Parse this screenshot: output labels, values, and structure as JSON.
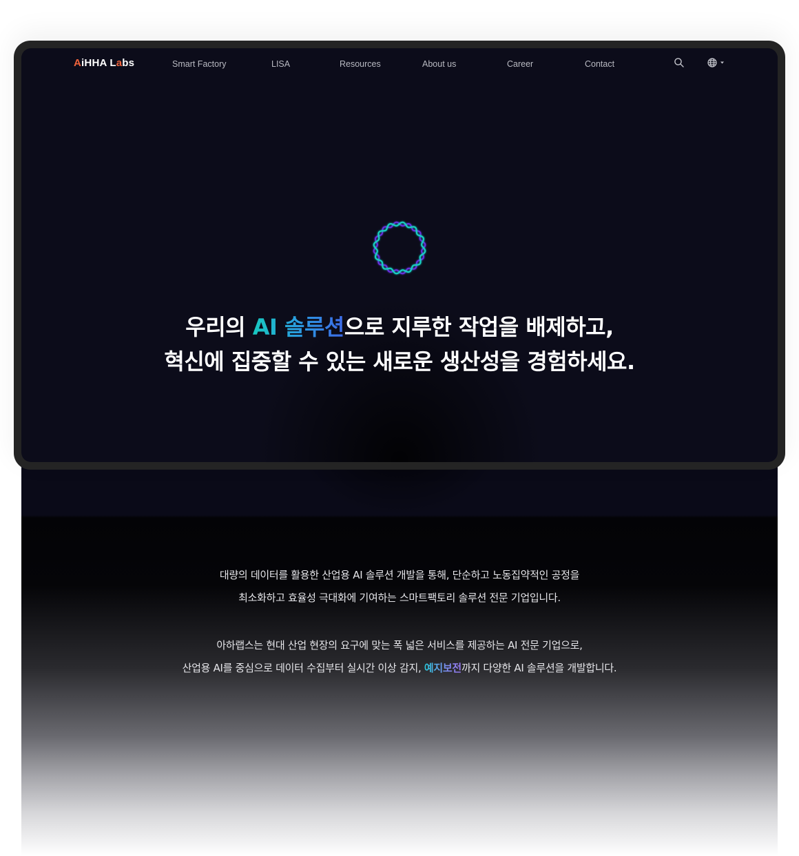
{
  "brand": {
    "logo_prefix": "A",
    "logo_mid": "iHHA L",
    "logo_accent": "a",
    "logo_suffix": "bs",
    "accent_color": "#f0643c"
  },
  "nav": {
    "items": [
      {
        "label": "Smart Factory"
      },
      {
        "label": "LISA"
      },
      {
        "label": "Resources"
      },
      {
        "label": "About us"
      },
      {
        "label": "Career"
      },
      {
        "label": "Contact"
      }
    ],
    "search_icon": "search-icon",
    "language_icon": "globe-icon",
    "language_dropdown_icon": "caret-down-icon"
  },
  "hero": {
    "ring_icon": "wavy-ring-icon",
    "ring_colors": [
      "#19d2c2",
      "#6a2fe0"
    ],
    "headline": {
      "line1_pre": "우리의 ",
      "line1_highlight": "AI 솔루션",
      "line1_post": "으로 지루한 작업을 배제하고,",
      "line2": "혁신에 집중할 수 있는 새로운 생산성을 경험하세요."
    },
    "highlight_gradient": [
      "#18c9c0",
      "#3d6ae8"
    ]
  },
  "intro": {
    "paragraph1": [
      "대량의 데이터를 활용한 산업용 AI 솔루션 개발을 통해, 단순하고 노동집약적인 공정을",
      "최소화하고 효율성 극대화에 기여하는 스마트팩토리 솔루션 전문 기업입니다."
    ],
    "paragraph2_line1": "아하랩스는 현대 산업 현장의 요구에 맞는 폭 넓은 서비스를 제공하는 AI 전문 기업으로,",
    "paragraph2_line2_pre": "산업용 AI를 중심으로 데이터 수집부터 실시간 이상 감지, ",
    "paragraph2_line2_highlight": "예지보전",
    "paragraph2_line2_post": "까지 다양한 AI 솔루션을 개발합니다.",
    "highlight_gradient": [
      "#27c6d8",
      "#9a78f0"
    ]
  }
}
